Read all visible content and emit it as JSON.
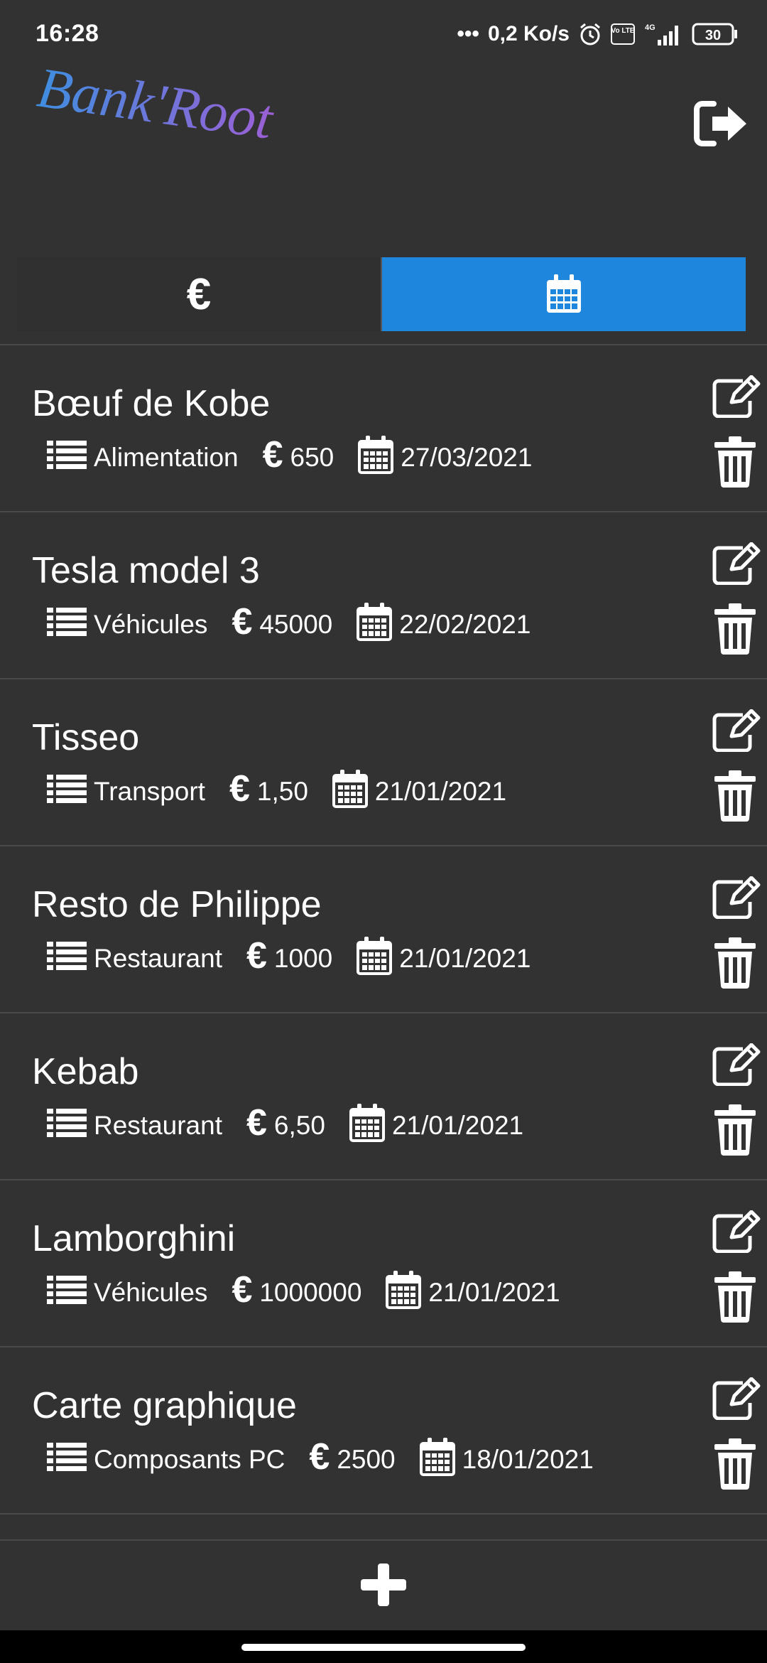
{
  "status": {
    "time": "16:28",
    "speed": "0,2 Ko/s",
    "network": "4G",
    "volte": "Vo LTE",
    "battery": "30"
  },
  "app": {
    "logo_text": "Bank'Root",
    "logout_icon": "sign-out-icon"
  },
  "toggle": {
    "euro_label": "€",
    "date_icon": "calendar-icon",
    "active": "date",
    "active_color": "#1f86de"
  },
  "expenses": [
    {
      "title": "Bœuf de Kobe",
      "category": "Alimentation",
      "amount": "650",
      "date": "27/03/2021"
    },
    {
      "title": "Tesla model 3",
      "category": "Véhicules",
      "amount": "45000",
      "date": "22/02/2021"
    },
    {
      "title": "Tisseo",
      "category": "Transport",
      "amount": "1,50",
      "date": "21/01/2021"
    },
    {
      "title": "Resto de Philippe",
      "category": "Restaurant",
      "amount": "1000",
      "date": "21/01/2021"
    },
    {
      "title": "Kebab",
      "category": "Restaurant",
      "amount": "6,50",
      "date": "21/01/2021"
    },
    {
      "title": "Lamborghini",
      "category": "Véhicules",
      "amount": "1000000",
      "date": "21/01/2021"
    },
    {
      "title": "Carte graphique",
      "category": "Composants PC",
      "amount": "2500",
      "date": "18/01/2021"
    }
  ],
  "currency_symbol": "€",
  "colors": {
    "background": "#323232",
    "accent": "#1f86de",
    "logo_start": "#3f8ee0",
    "logo_end": "#9b5fd6"
  }
}
